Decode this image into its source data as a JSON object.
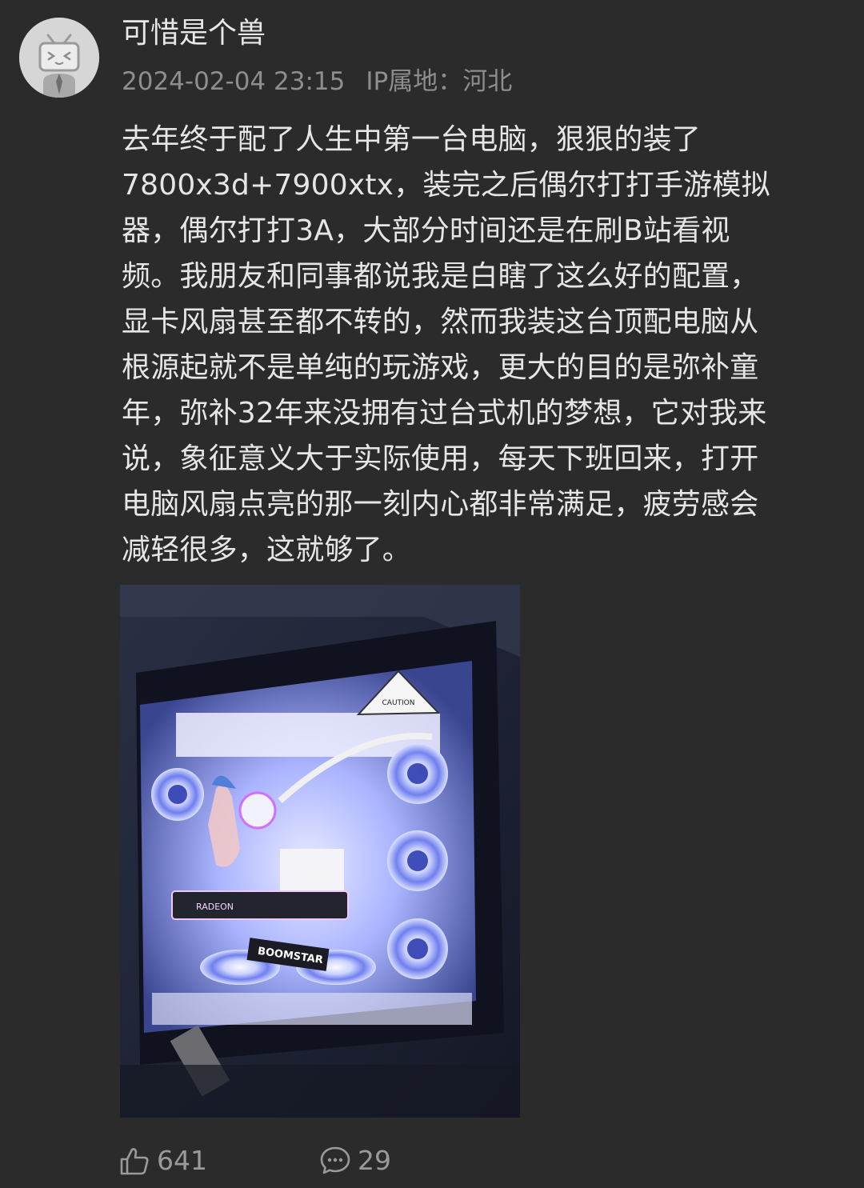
{
  "post": {
    "username": "可惜是个兽",
    "timestamp": "2024-02-04 23:15",
    "ip_location": "IP属地：河北",
    "text": "去年终于配了人生中第一台电脑，狠狠的装了\n7800x3d+7900xtx，装完之后偶尔打打手游模拟\n器，偶尔打打3A，大部分时间还是在刷B站看视\n频。我朋友和同事都说我是白瞎了这么好的配置，\n显卡风扇甚至都不转的，然而我装这台顶配电脑从\n根源起就不是单纯的玩游戏，更大的目的是弥补童\n年，弥补32年来没拥有过台式机的梦想，它对我来\n说，象征意义大于实际使用，每天下班回来，打开\n电脑风扇点亮的那一刻内心都非常满足，疲劳感会\n减轻很多，这就够了。",
    "image_labels": {
      "caution": "CAUTION",
      "gpu_brand": "RADEON",
      "boomstar": "BOOMSTAR"
    }
  },
  "actions": {
    "likes": "641",
    "comments": "29",
    "like_icon": "thumbs-up-icon",
    "comment_icon": "comment-bubble-icon"
  },
  "colors": {
    "background": "#2b2b2b",
    "text": "#e6e6e6",
    "meta": "#8e8e8e",
    "action": "#9a9a9a"
  }
}
